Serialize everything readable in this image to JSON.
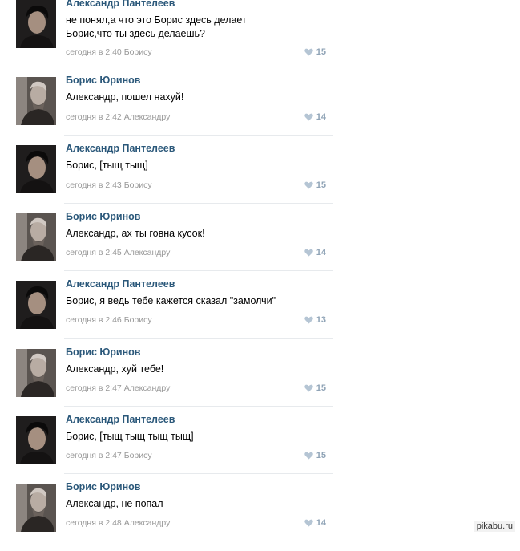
{
  "comments": [
    {
      "author": "Александр Пантелеев",
      "text": "не понял,а что это Борис здесь делает\nБорис,что ты здесь делаешь?",
      "time": "сегодня в 2:40",
      "reply_to": "Борису",
      "likes": "15"
    },
    {
      "author": "Борис Юринов",
      "text": "Александр, пошел нахуй!",
      "time": "сегодня в 2:42",
      "reply_to": "Александру",
      "likes": "14"
    },
    {
      "author": "Александр Пантелеев",
      "text": "Борис, [тыщ тыщ]",
      "time": "сегодня в 2:43",
      "reply_to": "Борису",
      "likes": "15"
    },
    {
      "author": "Борис Юринов",
      "text": "Александр, ах ты говна кусок!",
      "time": "сегодня в 2:45",
      "reply_to": "Александру",
      "likes": "14"
    },
    {
      "author": "Александр Пантелеев",
      "text": "Борис, я ведь тебе кажется сказал \"замолчи\"",
      "time": "сегодня в 2:46",
      "reply_to": "Борису",
      "likes": "13"
    },
    {
      "author": "Борис Юринов",
      "text": "Александр, хуй тебе!",
      "time": "сегодня в 2:47",
      "reply_to": "Александру",
      "likes": "15"
    },
    {
      "author": "Александр Пантелеев",
      "text": "Борис, [тыщ тыщ тыщ тыщ]",
      "time": "сегодня в 2:47",
      "reply_to": "Борису",
      "likes": "15"
    },
    {
      "author": "Борис Юринов",
      "text": "Александр, не попал",
      "time": "сегодня в 2:48",
      "reply_to": "Александру",
      "likes": "14"
    }
  ],
  "watermark": "pikabu.ru",
  "colors": {
    "author": "#2b587a",
    "meta": "#999999",
    "like": "#8fa3b6"
  },
  "icons": {
    "like": "heart-icon"
  }
}
